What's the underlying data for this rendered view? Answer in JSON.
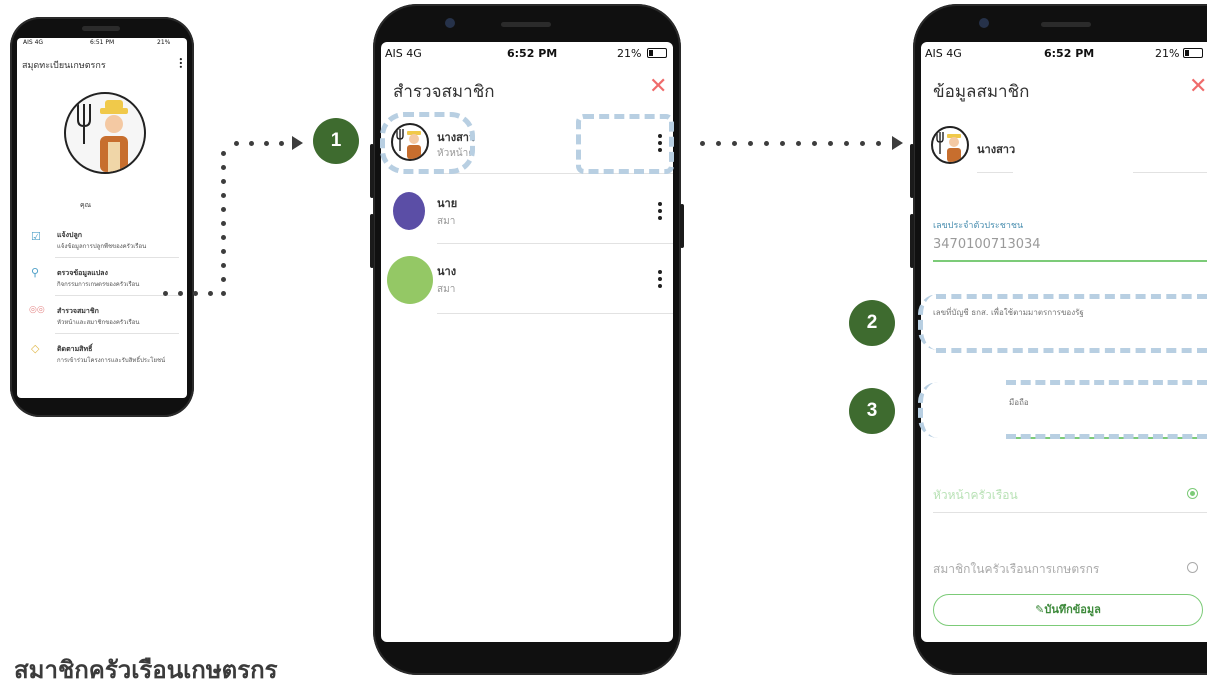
{
  "status": {
    "carrier_small": "AIS 4G",
    "time_small": "6:51 PM",
    "carrier": "AIS  4G",
    "time_mid": "6:52 PM",
    "time_right": "6:52 PM",
    "battery": "21%"
  },
  "phone1": {
    "title": "สมุดทะเบียนเกษตรกร",
    "user_name": "คุณ",
    "menu": [
      {
        "label": "แจ้งปลูก",
        "sub": "แจ้งข้อมูลการปลูกพืชของครัวเรือน",
        "icon": "edit-icon"
      },
      {
        "label": "ตรวจข้อมูลแปลง",
        "sub": "กิจกรรมการเกษตรของครัวเรือน",
        "icon": "search-icon"
      },
      {
        "label": "สำรวจสมาชิก",
        "sub": "หัวหน้าและสมาชิกของครัวเรือน",
        "icon": "group-icon"
      },
      {
        "label": "ติดตามสิทธิ์",
        "sub": "การเข้าร่วมโครงการและรับสิทธิ์ประโยชน์",
        "icon": "tag-icon"
      }
    ]
  },
  "phone2": {
    "title": "สำรวจสมาชิก",
    "members": [
      {
        "name": "นางสาว",
        "role": "หัวหน้าค",
        "avatar": "farmer-avatar"
      },
      {
        "name": "นาย",
        "role": "สมา",
        "avatar_color": "#5b4ea6"
      },
      {
        "name": "นาง",
        "role": "สมา",
        "avatar_color": "#94c865"
      }
    ]
  },
  "phone3": {
    "title": "ข้อมูลสมาชิก",
    "member_name": "นางสาว",
    "id_label": "เลขประจำตัวประชาชน",
    "id_value": "3470100713034",
    "bank_label": "เลขที่บัญชี ธกส. เพื่อใช้ตามมาตรการของรัฐ",
    "phone_label": "มือถือ",
    "option_head": "หัวหน้าครัวเรือน",
    "option_member": "สมาชิกในครัวเรือนการเกษตรกร",
    "save_label": "บันทึกข้อมูล"
  },
  "steps": [
    "1",
    "2",
    "3"
  ],
  "caption": "สมาชิกครัวเรือนเกษตรกร",
  "colors": {
    "accent_green": "#7ccb78",
    "step_badge": "#3e6b2f",
    "close_red": "#ef6b6b",
    "highlight_dash": "#b8cfe2"
  }
}
